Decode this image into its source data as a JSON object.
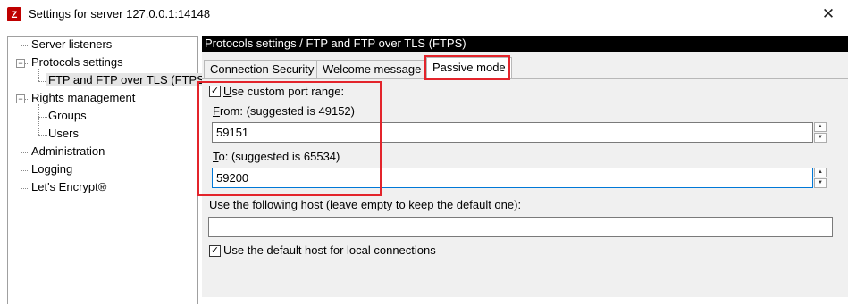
{
  "window": {
    "title": "Settings for server 127.0.0.1:14148",
    "close_glyph": "✕",
    "app_icon": "filezilla-icon"
  },
  "tree": {
    "items": [
      {
        "label": "Server listeners"
      },
      {
        "label": "Protocols settings"
      },
      {
        "label": "FTP and FTP over TLS (FTPS)"
      },
      {
        "label": "Rights management"
      },
      {
        "label": "Groups"
      },
      {
        "label": "Users"
      },
      {
        "label": "Administration"
      },
      {
        "label": "Logging"
      },
      {
        "label": "Let's Encrypt®"
      }
    ],
    "collapse_glyph": "−"
  },
  "panel": {
    "header": "Protocols settings / FTP and FTP over TLS (FTPS)",
    "tabs": [
      {
        "label": "Connection Security"
      },
      {
        "label": "Welcome message"
      },
      {
        "label": "Passive mode",
        "active": true
      }
    ]
  },
  "passive": {
    "use_custom_range": {
      "mnemonic": "U",
      "rest": "se custom port range:",
      "checked": true
    },
    "from": {
      "mnemonic": "F",
      "rest": "rom: (suggested is 49152)",
      "value": "59151"
    },
    "to": {
      "mnemonic": "T",
      "rest": "o: (suggested is 65534)",
      "value": "59200"
    },
    "host": {
      "before": "Use the following ",
      "mnemonic": "h",
      "after": "ost (leave empty to keep the default one):",
      "value": ""
    },
    "default_host": {
      "label": "Use the default host for local connections",
      "checked": true
    }
  },
  "glyphs": {
    "check": "✓",
    "spin_up": "▲",
    "spin_down": "▼"
  },
  "colors": {
    "highlight_box": "#e3242b",
    "header_bg": "#000000",
    "focus_border": "#0078d7"
  }
}
